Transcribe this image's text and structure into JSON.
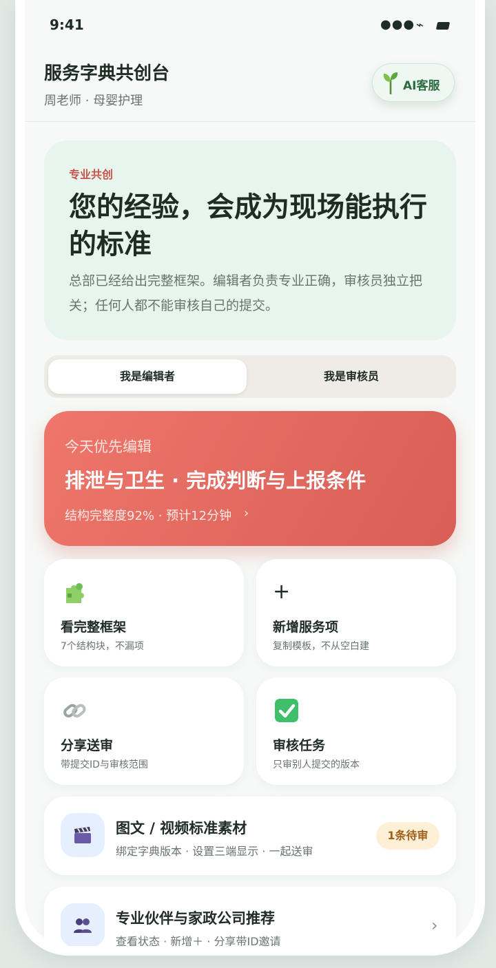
{
  "status": {
    "time": "9:41",
    "signal": "●●●",
    "network": "⌁"
  },
  "header": {
    "title": "服务字典共创台",
    "user": "周老师 · 母婴护理",
    "ai_button": "AI客服"
  },
  "hero": {
    "tag": "专业共创",
    "title": "您的经验，会成为现场能执行的标准",
    "desc": "总部已经给出完整框架。编辑者负责专业正确，审核员独立把关；任何人都不能审核自己的提交。"
  },
  "role_tabs": [
    {
      "label": "我是编辑者",
      "active": true
    },
    {
      "label": "我是审核员",
      "active": false
    }
  ],
  "priority": {
    "label": "今天优先编辑",
    "title": "排泄与卫生 · 完成判断与上报条件",
    "meta": "结构完整度92% · 预计12分钟",
    "chevron": "›"
  },
  "cards": [
    {
      "icon": "puzzle-icon",
      "title": "看完整框架",
      "sub": "7个结构块，不漏项"
    },
    {
      "icon": "plus-icon",
      "glyph": "+",
      "title": "新增服务项",
      "sub": "复制模板，不从空白建"
    },
    {
      "icon": "link-icon",
      "title": "分享送审",
      "sub": "带提交ID与审核范围"
    },
    {
      "icon": "check-icon",
      "title": "审核任务",
      "sub": "只审别人提交的版本"
    }
  ],
  "rows": [
    {
      "icon": "clapper-icon",
      "title": "图文 / 视频标准素材",
      "sub": "绑定字典版本 · 设置三端显示 · 一起送审",
      "badge": "1条待审"
    },
    {
      "icon": "people-icon",
      "title": "专业伙伴与家政公司推荐",
      "sub": "查看状态 · 新增＋ · 分享带ID邀请",
      "chevron": "›"
    }
  ],
  "colors": {
    "accent_green": "#2a6b41",
    "accent_red": "#d85e56",
    "hero_bg": "#e8f5ee",
    "badge_bg": "#fdf0d6"
  }
}
